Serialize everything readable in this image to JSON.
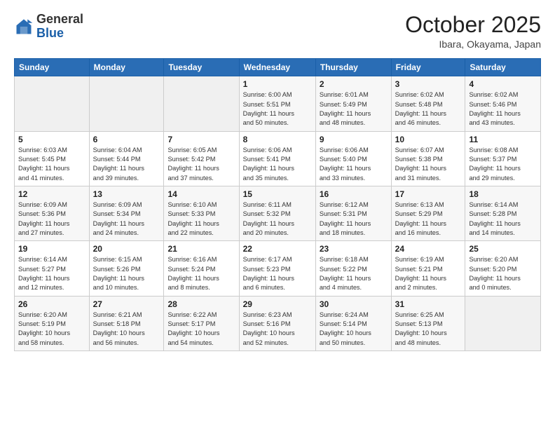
{
  "logo": {
    "general": "General",
    "blue": "Blue"
  },
  "header": {
    "month": "October 2025",
    "location": "Ibara, Okayama, Japan"
  },
  "weekdays": [
    "Sunday",
    "Monday",
    "Tuesday",
    "Wednesday",
    "Thursday",
    "Friday",
    "Saturday"
  ],
  "weeks": [
    [
      {
        "day": "",
        "info": ""
      },
      {
        "day": "",
        "info": ""
      },
      {
        "day": "",
        "info": ""
      },
      {
        "day": "1",
        "info": "Sunrise: 6:00 AM\nSunset: 5:51 PM\nDaylight: 11 hours\nand 50 minutes."
      },
      {
        "day": "2",
        "info": "Sunrise: 6:01 AM\nSunset: 5:49 PM\nDaylight: 11 hours\nand 48 minutes."
      },
      {
        "day": "3",
        "info": "Sunrise: 6:02 AM\nSunset: 5:48 PM\nDaylight: 11 hours\nand 46 minutes."
      },
      {
        "day": "4",
        "info": "Sunrise: 6:02 AM\nSunset: 5:46 PM\nDaylight: 11 hours\nand 43 minutes."
      }
    ],
    [
      {
        "day": "5",
        "info": "Sunrise: 6:03 AM\nSunset: 5:45 PM\nDaylight: 11 hours\nand 41 minutes."
      },
      {
        "day": "6",
        "info": "Sunrise: 6:04 AM\nSunset: 5:44 PM\nDaylight: 11 hours\nand 39 minutes."
      },
      {
        "day": "7",
        "info": "Sunrise: 6:05 AM\nSunset: 5:42 PM\nDaylight: 11 hours\nand 37 minutes."
      },
      {
        "day": "8",
        "info": "Sunrise: 6:06 AM\nSunset: 5:41 PM\nDaylight: 11 hours\nand 35 minutes."
      },
      {
        "day": "9",
        "info": "Sunrise: 6:06 AM\nSunset: 5:40 PM\nDaylight: 11 hours\nand 33 minutes."
      },
      {
        "day": "10",
        "info": "Sunrise: 6:07 AM\nSunset: 5:38 PM\nDaylight: 11 hours\nand 31 minutes."
      },
      {
        "day": "11",
        "info": "Sunrise: 6:08 AM\nSunset: 5:37 PM\nDaylight: 11 hours\nand 29 minutes."
      }
    ],
    [
      {
        "day": "12",
        "info": "Sunrise: 6:09 AM\nSunset: 5:36 PM\nDaylight: 11 hours\nand 27 minutes."
      },
      {
        "day": "13",
        "info": "Sunrise: 6:09 AM\nSunset: 5:34 PM\nDaylight: 11 hours\nand 24 minutes."
      },
      {
        "day": "14",
        "info": "Sunrise: 6:10 AM\nSunset: 5:33 PM\nDaylight: 11 hours\nand 22 minutes."
      },
      {
        "day": "15",
        "info": "Sunrise: 6:11 AM\nSunset: 5:32 PM\nDaylight: 11 hours\nand 20 minutes."
      },
      {
        "day": "16",
        "info": "Sunrise: 6:12 AM\nSunset: 5:31 PM\nDaylight: 11 hours\nand 18 minutes."
      },
      {
        "day": "17",
        "info": "Sunrise: 6:13 AM\nSunset: 5:29 PM\nDaylight: 11 hours\nand 16 minutes."
      },
      {
        "day": "18",
        "info": "Sunrise: 6:14 AM\nSunset: 5:28 PM\nDaylight: 11 hours\nand 14 minutes."
      }
    ],
    [
      {
        "day": "19",
        "info": "Sunrise: 6:14 AM\nSunset: 5:27 PM\nDaylight: 11 hours\nand 12 minutes."
      },
      {
        "day": "20",
        "info": "Sunrise: 6:15 AM\nSunset: 5:26 PM\nDaylight: 11 hours\nand 10 minutes."
      },
      {
        "day": "21",
        "info": "Sunrise: 6:16 AM\nSunset: 5:24 PM\nDaylight: 11 hours\nand 8 minutes."
      },
      {
        "day": "22",
        "info": "Sunrise: 6:17 AM\nSunset: 5:23 PM\nDaylight: 11 hours\nand 6 minutes."
      },
      {
        "day": "23",
        "info": "Sunrise: 6:18 AM\nSunset: 5:22 PM\nDaylight: 11 hours\nand 4 minutes."
      },
      {
        "day": "24",
        "info": "Sunrise: 6:19 AM\nSunset: 5:21 PM\nDaylight: 11 hours\nand 2 minutes."
      },
      {
        "day": "25",
        "info": "Sunrise: 6:20 AM\nSunset: 5:20 PM\nDaylight: 11 hours\nand 0 minutes."
      }
    ],
    [
      {
        "day": "26",
        "info": "Sunrise: 6:20 AM\nSunset: 5:19 PM\nDaylight: 10 hours\nand 58 minutes."
      },
      {
        "day": "27",
        "info": "Sunrise: 6:21 AM\nSunset: 5:18 PM\nDaylight: 10 hours\nand 56 minutes."
      },
      {
        "day": "28",
        "info": "Sunrise: 6:22 AM\nSunset: 5:17 PM\nDaylight: 10 hours\nand 54 minutes."
      },
      {
        "day": "29",
        "info": "Sunrise: 6:23 AM\nSunset: 5:16 PM\nDaylight: 10 hours\nand 52 minutes."
      },
      {
        "day": "30",
        "info": "Sunrise: 6:24 AM\nSunset: 5:14 PM\nDaylight: 10 hours\nand 50 minutes."
      },
      {
        "day": "31",
        "info": "Sunrise: 6:25 AM\nSunset: 5:13 PM\nDaylight: 10 hours\nand 48 minutes."
      },
      {
        "day": "",
        "info": ""
      }
    ]
  ]
}
